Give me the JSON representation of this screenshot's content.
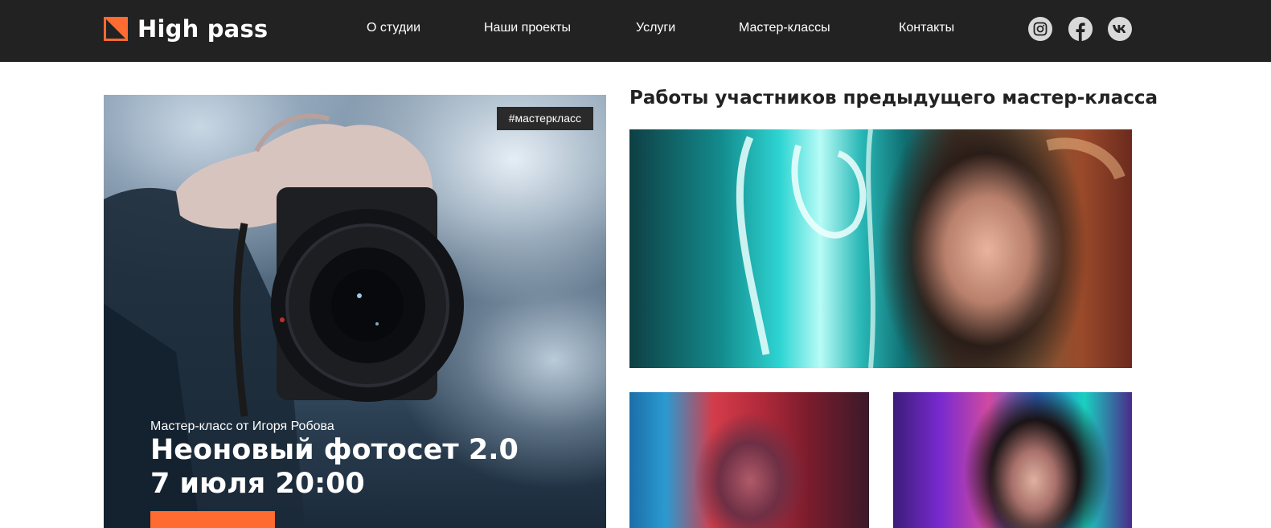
{
  "header": {
    "logo_text": "High pass",
    "nav": [
      "О студии",
      "Наши проекты",
      "Услуги",
      "Мастер-классы",
      "Контакты"
    ],
    "social": [
      "instagram-icon",
      "facebook-icon",
      "vk-icon"
    ]
  },
  "hero": {
    "tag": "#мастеркласс",
    "subtitle": "Мастер-класс от Игоря Робова",
    "title_line1": "Неоновый фотосет 2.0",
    "title_line2": "7 июля 20:00"
  },
  "gallery": {
    "title": "Работы участников предыдущего мастер-класса"
  },
  "colors": {
    "header_bg": "#222222",
    "accent": "#ff6b30",
    "social_bg": "#d9d9d9"
  }
}
